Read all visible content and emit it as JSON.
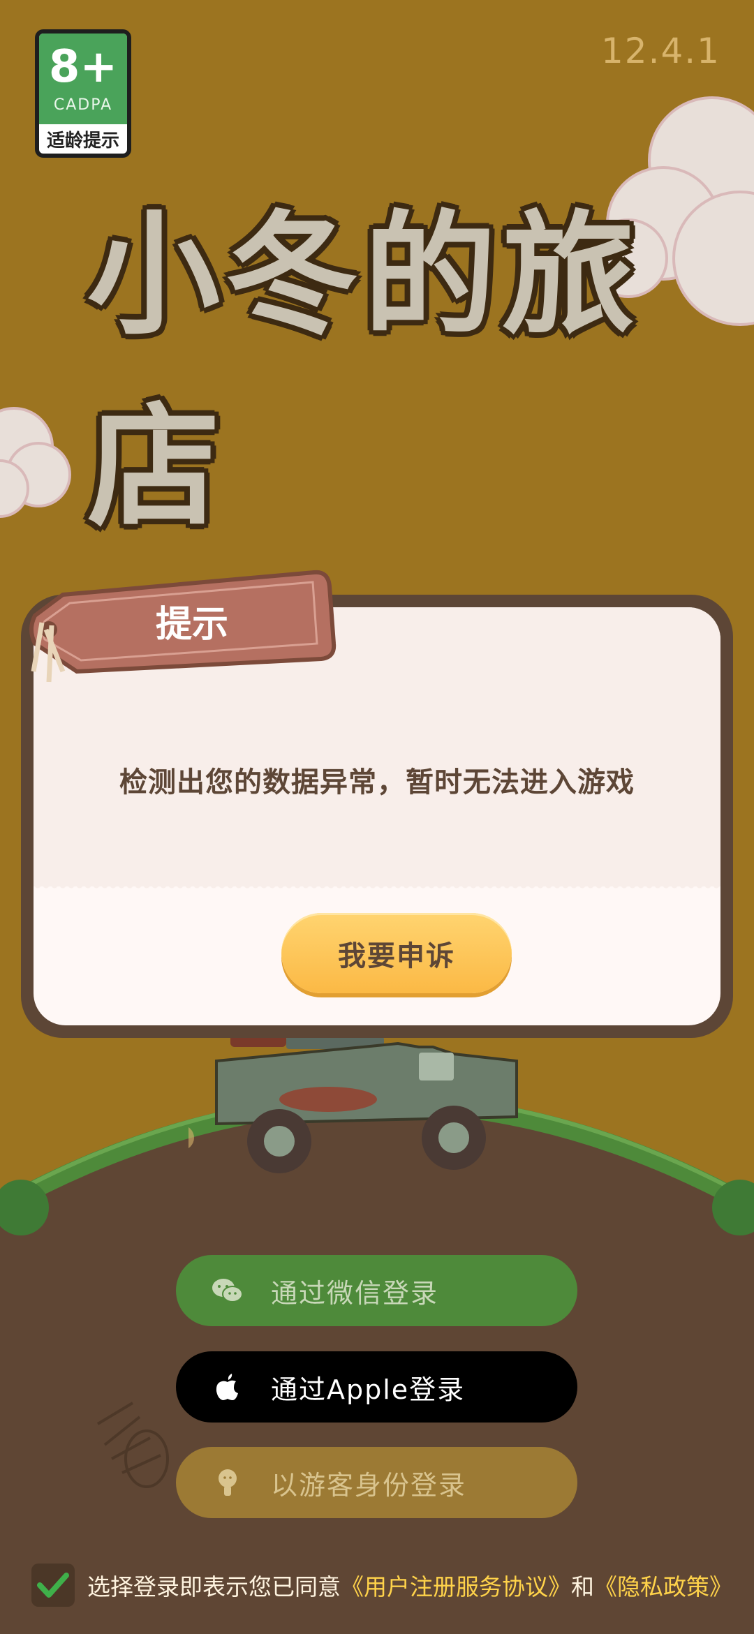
{
  "age_rating": {
    "value": "8+",
    "org": "CADPA",
    "label": "适龄提示"
  },
  "version": "12.4.1",
  "logo_text": "小冬的旅店",
  "dialog": {
    "title": "提示",
    "message": "检测出您的数据异常，暂时无法进入游戏",
    "appeal_button": "我要申诉"
  },
  "login": {
    "wechat_label": "通过微信登录",
    "apple_label": "通过Apple登录",
    "guest_label": "以游客身份登录",
    "icons": [
      "wechat-icon",
      "apple-icon",
      "guest-icon"
    ]
  },
  "agreement": {
    "prefix": "选择登录即表示您已同意",
    "user_agreement": "《用户注册服务协议》",
    "conjunction": "和",
    "privacy_policy": "《隐私政策》",
    "checked": true
  },
  "colors": {
    "background": "#9c7420",
    "dialog_border": "#5d4636",
    "button_yellow": "#fbb945",
    "wechat_green": "#4e8a3a",
    "link_yellow": "#ffd34a"
  }
}
